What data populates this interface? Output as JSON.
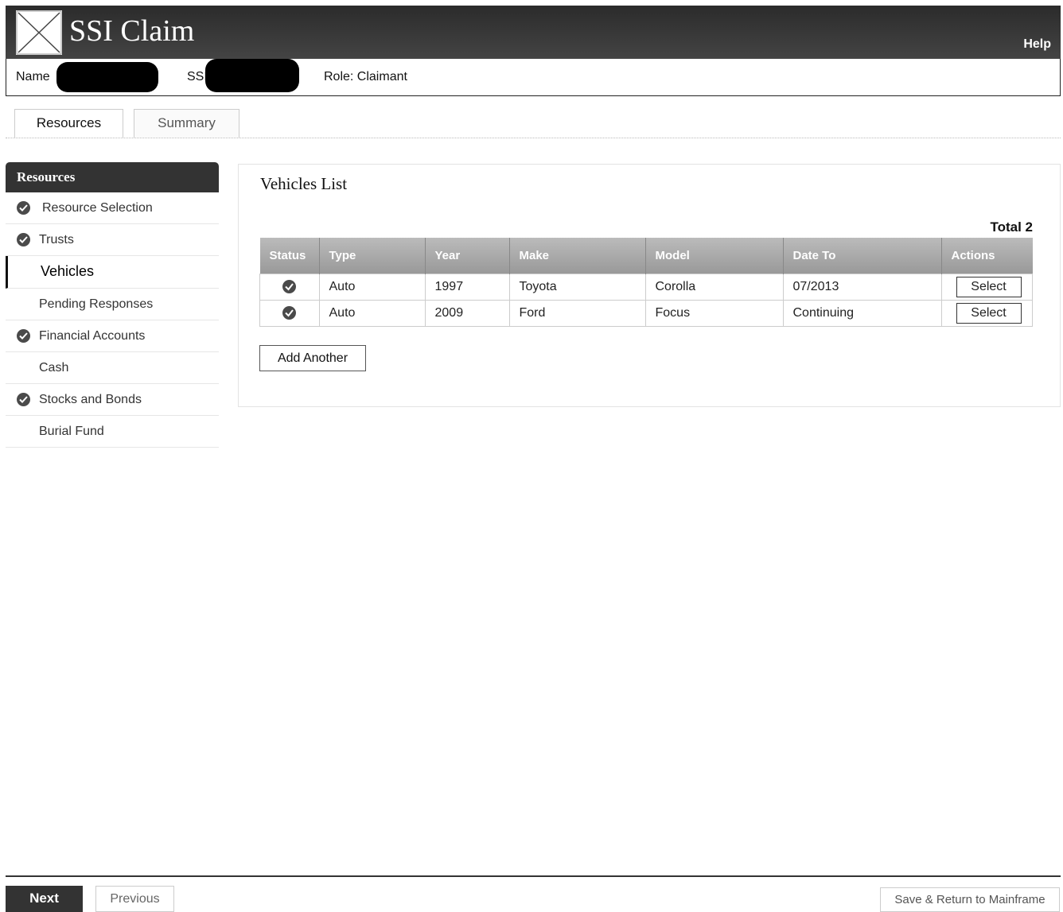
{
  "app": {
    "title": "SSI Claim",
    "help": "Help",
    "logo_icon": "x-box-logo"
  },
  "claimant": {
    "name_label": "Name",
    "ssn_label": "SSI",
    "role_label": "Role: Claimant"
  },
  "tabs": [
    {
      "label": "Resources",
      "active": true
    },
    {
      "label": "Summary",
      "active": false
    }
  ],
  "sidebar": {
    "header": "Resources",
    "items": [
      {
        "label": "Resource Selection",
        "completed": true,
        "active": false
      },
      {
        "label": "Trusts",
        "completed": true,
        "active": false
      },
      {
        "label": "Vehicles",
        "completed": false,
        "active": true
      },
      {
        "label": "Pending Responses",
        "completed": false,
        "active": false
      },
      {
        "label": "Financial Accounts",
        "completed": true,
        "active": false
      },
      {
        "label": "Cash",
        "completed": false,
        "active": false
      },
      {
        "label": "Stocks and Bonds",
        "completed": true,
        "active": false
      },
      {
        "label": "Burial Fund",
        "completed": false,
        "active": false
      }
    ]
  },
  "main": {
    "title": "Vehicles List",
    "total": "Total 2",
    "columns": [
      "Status",
      "Type",
      "Year",
      "Make",
      "Model",
      "Date To",
      "Actions"
    ],
    "rows": [
      {
        "status_icon": "check-circle-icon",
        "type": "Auto",
        "year": "1997",
        "make": "Toyota",
        "model": "Corolla",
        "date_to": "07/2013",
        "action": "Select"
      },
      {
        "status_icon": "check-circle-icon",
        "type": "Auto",
        "year": "2009",
        "make": "Ford",
        "model": "Focus",
        "date_to": "Continuing",
        "action": "Select"
      }
    ],
    "add_button": "Add Another"
  },
  "footer": {
    "next": "Next",
    "previous": "Previous",
    "save_return": "Save & Return to Mainframe"
  },
  "colors": {
    "header_bg": "#333333",
    "table_header_bg": "#aaaaaa",
    "check_icon": "#4a4a4a"
  }
}
